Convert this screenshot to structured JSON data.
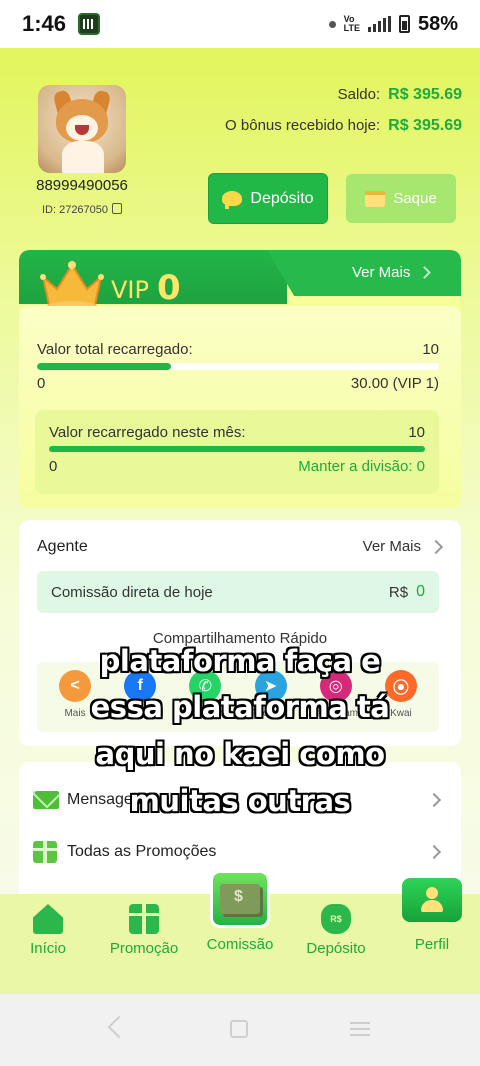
{
  "status_bar": {
    "time": "1:46",
    "network": "Vo LTE",
    "battery": "58%"
  },
  "profile": {
    "phone": "88999490056",
    "id_label": "ID: 27267050"
  },
  "balance": {
    "saldo_label": "Saldo:",
    "saldo_value": "R$ 395.69",
    "bonus_label": "O bônus recebido hoje:",
    "bonus_value": "R$ 395.69"
  },
  "actions": {
    "deposit_label": "Depósito",
    "withdraw_label": "Saque"
  },
  "vip": {
    "label": "VIP",
    "level": "0",
    "more_label": "Ver Mais",
    "total_label": "Valor total recarregado:",
    "total_value": "10",
    "progress_fraction": 0.333,
    "min": "0",
    "max": "30.00 (VIP 1)",
    "month_label": "Valor recarregado neste mês:",
    "month_value": "10",
    "month_min": "0",
    "month_keep": "Manter a divisão: 0"
  },
  "agent": {
    "title": "Agente",
    "more_label": "Ver Mais",
    "commission_label": "Comissão direta de hoje",
    "commission_currency": "R$",
    "commission_value": "0",
    "share_title": "Compartilhamento Rápido",
    "share_items": [
      {
        "label": "Mais",
        "icon": "share-icon",
        "color": "#f59a3c"
      },
      {
        "label": "Facebook",
        "icon": "facebook-icon",
        "color": "#1877f2"
      },
      {
        "label": "WhatsApp",
        "icon": "whatsapp-icon",
        "color": "#25d366"
      },
      {
        "label": "Telegram",
        "icon": "telegram-icon",
        "color": "#2aa3df"
      },
      {
        "label": "Instagram",
        "icon": "instagram-icon",
        "color": "#d6297a"
      },
      {
        "label": "Kwai",
        "icon": "kwai-icon",
        "color": "#ff6a2b"
      }
    ]
  },
  "menu": {
    "messages_label": "Mensagens",
    "promotions_label": "Todas as Promoções"
  },
  "caption": {
    "line1": "plataforma faça e",
    "line2": "essa plataforma tá",
    "line3": "aqui no kaei como",
    "line4": "muitas outras"
  },
  "bottom_nav": {
    "home": "Início",
    "promo": "Promoção",
    "commission": "Comissão",
    "deposit": "Depósito",
    "profile": "Perfil"
  },
  "colors": {
    "accent_green": "#1faa3c",
    "vip_gold": "#fde66a"
  }
}
